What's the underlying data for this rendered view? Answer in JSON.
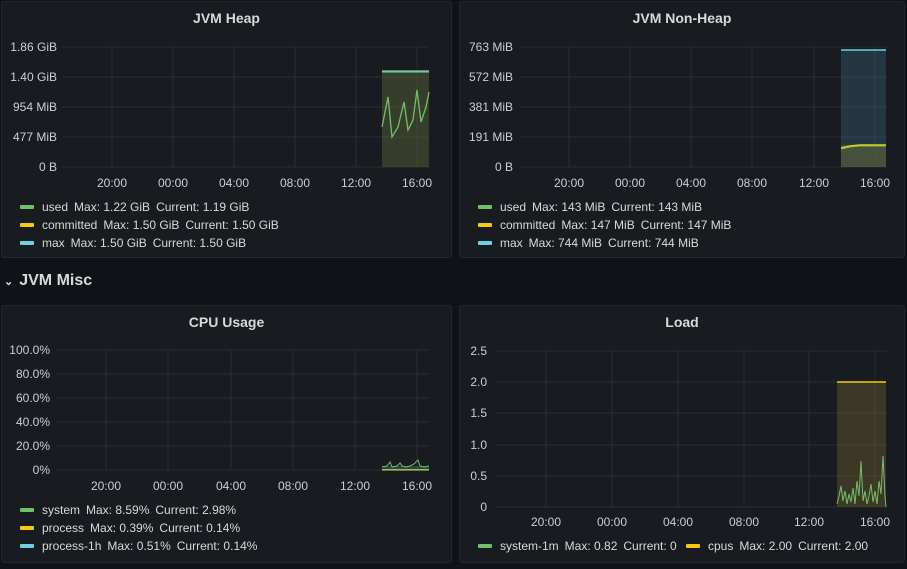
{
  "colors": {
    "used": "#73bf69",
    "committed": "#f2cc0c",
    "max": "#8ab8ff",
    "max_heap": "#73bf69",
    "cyan": "#6ed0e0",
    "system": "#73bf69",
    "process": "#f2cc0c",
    "process_1h": "#6ed0e0",
    "load_system": "#73bf69",
    "load_cpus": "#f2cc0c"
  },
  "x_ticks": [
    "20:00",
    "00:00",
    "04:00",
    "08:00",
    "12:00",
    "16:00"
  ],
  "panels": {
    "jvm_heap": {
      "title": "JVM Heap",
      "y_ticks": [
        "1.86 GiB",
        "1.40 GiB",
        "954 MiB",
        "477 MiB",
        "0 B"
      ],
      "legend": [
        {
          "name": "used",
          "max": "Max: 1.22 GiB",
          "current": "Current: 1.19 GiB",
          "color": "#73bf69"
        },
        {
          "name": "committed",
          "max": "Max: 1.50 GiB",
          "current": "Current: 1.50 GiB",
          "color": "#f2cc0c"
        },
        {
          "name": "max",
          "max": "Max: 1.50 GiB",
          "current": "Current: 1.50 GiB",
          "color": "#6ed0e0"
        }
      ]
    },
    "jvm_non_heap": {
      "title": "JVM Non-Heap",
      "y_ticks": [
        "763 MiB",
        "572 MiB",
        "381 MiB",
        "191 MiB",
        "0 B"
      ],
      "legend": [
        {
          "name": "used",
          "max": "Max: 143 MiB",
          "current": "Current: 143 MiB",
          "color": "#73bf69"
        },
        {
          "name": "committed",
          "max": "Max: 147 MiB",
          "current": "Current: 147 MiB",
          "color": "#f2cc0c"
        },
        {
          "name": "max",
          "max": "Max: 744 MiB",
          "current": "Current: 744 MiB",
          "color": "#6ed0e0"
        }
      ]
    },
    "cpu_usage": {
      "title": "CPU Usage",
      "y_ticks": [
        "100.0%",
        "80.0%",
        "60.0%",
        "40.0%",
        "20.0%",
        "0%"
      ],
      "legend": [
        {
          "name": "system",
          "max": "Max: 8.59%",
          "current": "Current: 2.98%",
          "color": "#73bf69"
        },
        {
          "name": "process",
          "max": "Max: 0.39%",
          "current": "Current: 0.14%",
          "color": "#f2cc0c"
        },
        {
          "name": "process-1h",
          "max": "Max: 0.51%",
          "current": "Current: 0.14%",
          "color": "#6ed0e0"
        }
      ]
    },
    "load": {
      "title": "Load",
      "y_ticks": [
        "2.5",
        "2.0",
        "1.5",
        "1.0",
        "0.5",
        "0"
      ],
      "legend": [
        {
          "name": "system-1m",
          "max": "Max: 0.82",
          "current": "Current: 0",
          "color": "#73bf69"
        },
        {
          "name": "cpus",
          "max": "Max: 2.00",
          "current": "Current: 2.00",
          "color": "#f2cc0c"
        }
      ]
    }
  },
  "row_header": {
    "chevron": "⌄",
    "title": "JVM Misc"
  }
}
